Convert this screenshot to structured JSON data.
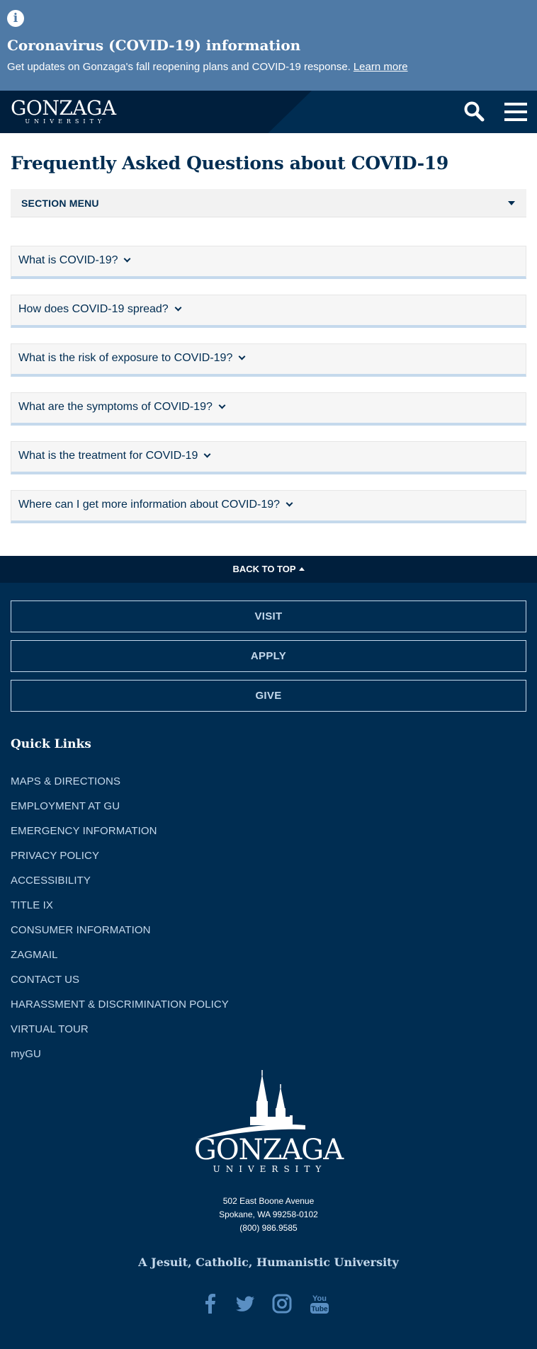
{
  "alert": {
    "icon": "info-icon",
    "title": "Coronavirus (COVID-19) information",
    "text": "Get updates on Gonzaga's fall reopening plans and COVID-19 response.",
    "link": "Learn more"
  },
  "header": {
    "logo_main": "GONZAGA",
    "logo_sub": "UNIVERSITY"
  },
  "main": {
    "title": "Frequently Asked Questions about COVID-19",
    "section_menu": "SECTION MENU",
    "faqs": [
      "What is COVID-19?",
      "How does COVID-19 spread?",
      "What is the risk of exposure to COVID-19?",
      "What are the symptoms of COVID-19?",
      "What is the treatment for COVID-19",
      "Where can I get more information about COVID-19?"
    ]
  },
  "back_to_top": "BACK TO TOP",
  "footer": {
    "cta": [
      "VISIT",
      "APPLY",
      "GIVE"
    ],
    "quick_links_title": "Quick Links",
    "quick_links": [
      "MAPS & DIRECTIONS",
      "EMPLOYMENT AT GU",
      "EMERGENCY INFORMATION",
      "PRIVACY POLICY",
      "ACCESSIBILITY",
      "TITLE IX",
      "CONSUMER INFORMATION",
      "ZAGMAIL",
      "CONTACT US",
      "HARASSMENT & DISCRIMINATION POLICY",
      "VIRTUAL TOUR",
      "myGU"
    ],
    "logo_main": "GONZAGA",
    "logo_sub": "UNIVERSITY",
    "address_line1": "502 East Boone Avenue",
    "address_line2": "Spokane, WA 99258-0102",
    "phone": "(800) 986.9585",
    "tagline": "A Jesuit, Catholic, Humanistic University",
    "social": [
      "facebook-icon",
      "twitter-icon",
      "instagram-icon",
      "youtube-icon"
    ],
    "youtube_text": "You Tube"
  },
  "colors": {
    "navy": "#002d52",
    "navy_dark": "#001f3d",
    "alert_blue": "#4f7aa6",
    "light_blue": "#c5d9ec"
  }
}
